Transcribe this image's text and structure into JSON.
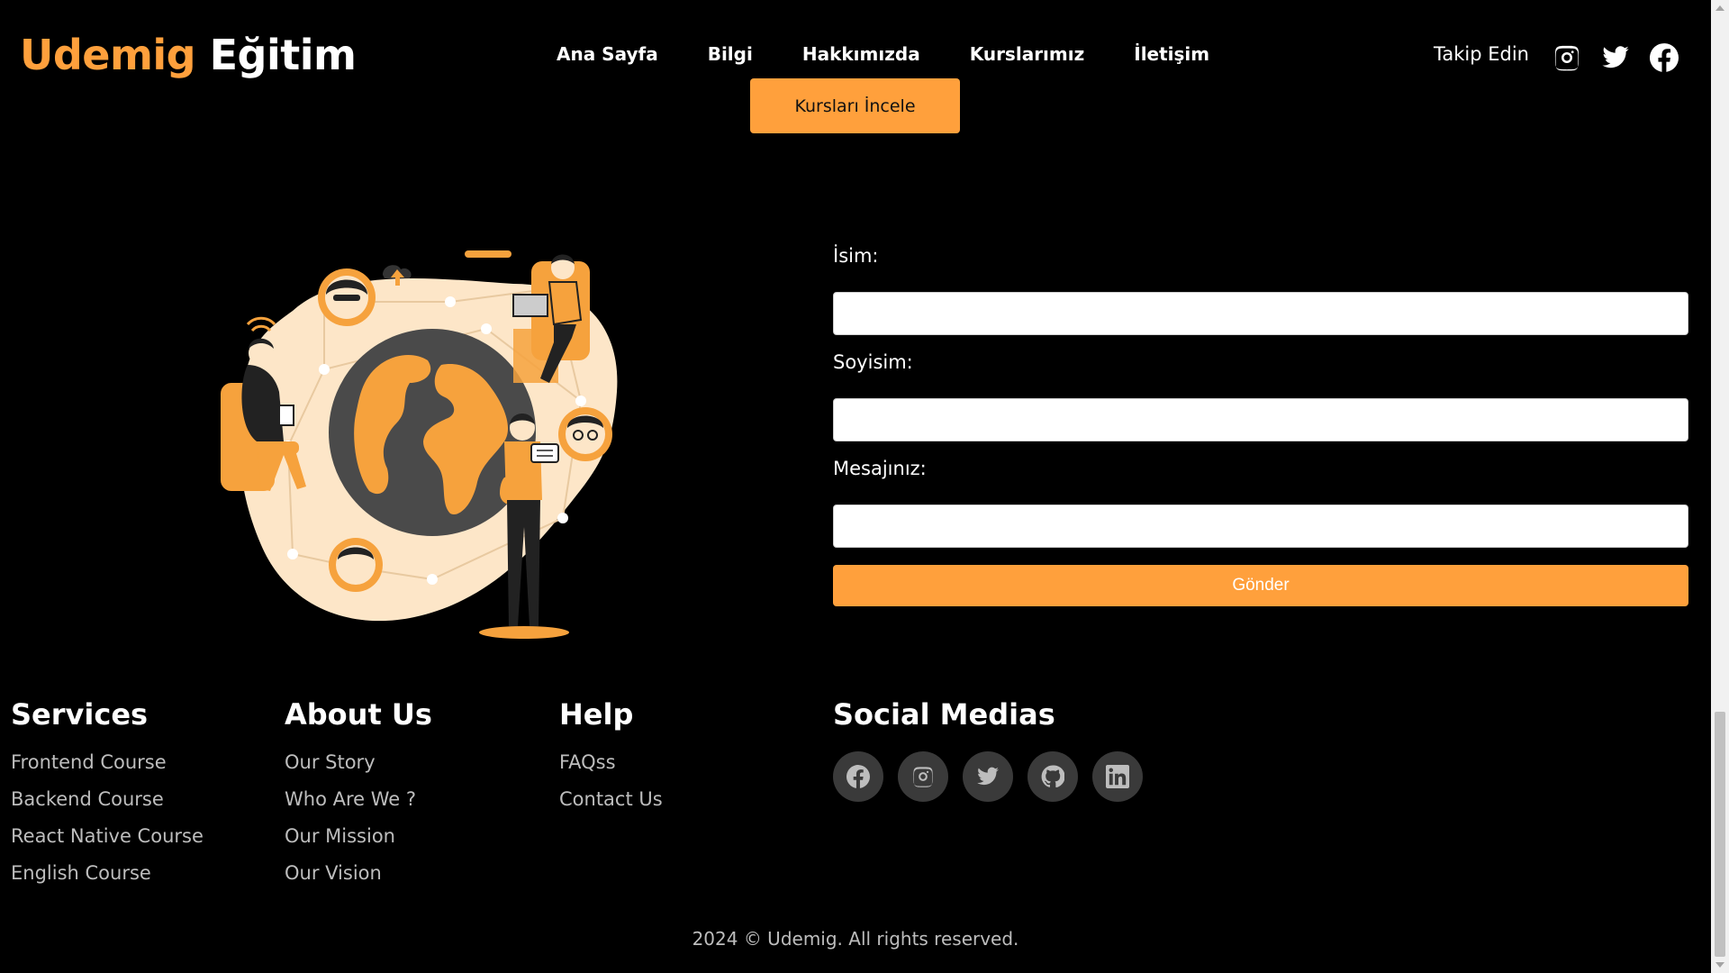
{
  "header": {
    "logo_brand": "Udemig",
    "logo_rest": "Eğitim",
    "nav": [
      "Ana Sayfa",
      "Bilgi",
      "Hakkımızda",
      "Kurslarımız",
      "İletişim"
    ],
    "follow_label": "Takip Edin",
    "icons": [
      "instagram-icon",
      "twitter-icon",
      "facebook-icon"
    ]
  },
  "cta": {
    "label": "Kursları İncele"
  },
  "form": {
    "name_label": "İsim:",
    "surname_label": "Soyisim:",
    "message_label": "Mesajınız:",
    "name_value": "",
    "surname_value": "",
    "message_value": "",
    "submit_label": "Gönder"
  },
  "footer": {
    "services": {
      "title": "Services",
      "items": [
        "Frontend Course",
        "Backend Course",
        "React Native Course",
        "English Course"
      ]
    },
    "about": {
      "title": "About Us",
      "items": [
        "Our Story",
        "Who Are We ?",
        "Our Mission",
        "Our Vision"
      ]
    },
    "help": {
      "title": "Help",
      "items": [
        "FAQss",
        "Contact Us"
      ]
    },
    "social": {
      "title": "Social Medias",
      "icons": [
        "facebook-icon",
        "instagram-icon",
        "twitter-icon",
        "github-icon",
        "linkedin-icon"
      ]
    },
    "copyright": "2024 © Udemig. All rights reserved."
  },
  "colors": {
    "accent": "#ffa03c",
    "background": "#000000",
    "muted_text": "#bdbdbd",
    "social_bg": "#3a3a3a"
  }
}
